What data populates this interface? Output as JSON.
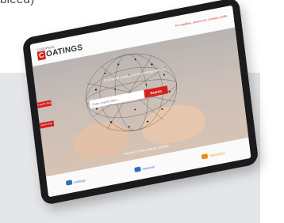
{
  "caption": "bleed)",
  "site": {
    "logo_small": "EUROPEAN",
    "logo_letter": "C",
    "logo_rest": "OATINGS",
    "top_link": "For suppliers, access your company profile",
    "tagline": "Find all the suppliers of the coatings industry",
    "search_placeholder": "Enter search term...",
    "search_button": "Search",
    "side_tab_1": "Supplier Map",
    "side_tab_2": "Event Map",
    "partners_caption": "Partners of the coatings industry",
    "partners": [
      "coatings",
      "eurocoat",
      "VINCENTZ"
    ]
  },
  "colors": {
    "brand_red": "#d4201f",
    "partner_blue": "#2e6fb8",
    "partner_orange": "#f08a1c"
  }
}
